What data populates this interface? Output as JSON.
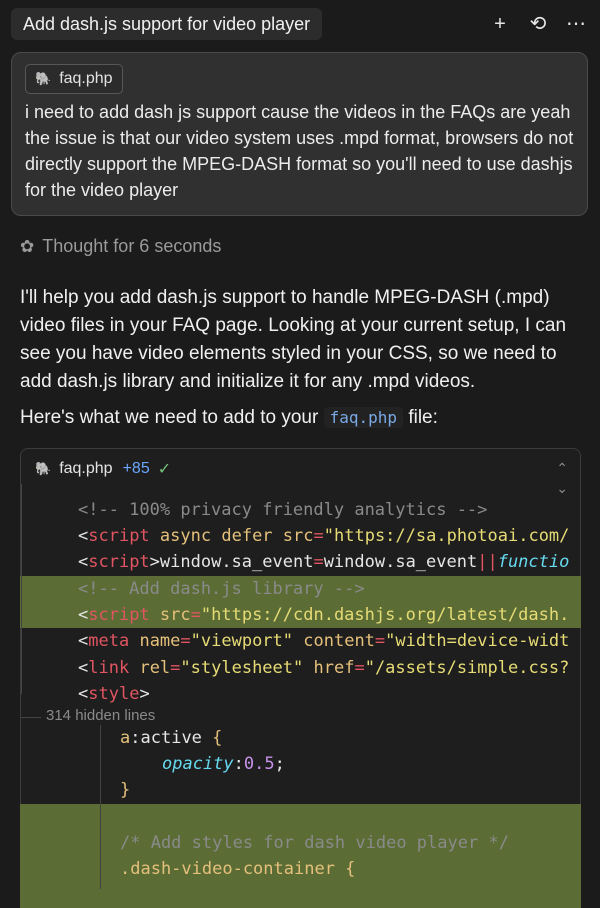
{
  "header": {
    "title": "Add dash.js support for video player",
    "icons": [
      "plus-icon",
      "history-icon",
      "more-icon"
    ]
  },
  "user_message": {
    "file_chip": "faq.php",
    "text": "i need to add dash js support cause the videos in the FAQs are yeah the issue is that our video system uses .mpd format, browsers do not directly support the MPEG-DASH format so you'll need to use dashjs for the video player"
  },
  "thought": {
    "label": "Thought for 6 seconds"
  },
  "answer": {
    "paragraph": "I'll help you add dash.js support to handle MPEG-DASH (.mpd) video files in your FAQ page. Looking at your current setup, I can see you have video elements styled in your CSS, so we need to add dash.js library and initialize it for any .mpd videos.",
    "intro_prefix": "Here's what we need to add to your",
    "intro_file": "faq.php",
    "intro_suffix": "file:"
  },
  "code_block": {
    "file": "faq.php",
    "added_lines": "+85",
    "hidden_lines": "314 hidden lines",
    "lines": [
      {
        "added": false,
        "indent": 0,
        "tokens": [
          [
            "comment",
            "<!-- 100% privacy friendly analytics -->"
          ]
        ]
      },
      {
        "added": false,
        "indent": 0,
        "tokens": [
          [
            "plain",
            "<"
          ],
          [
            "tag",
            "script"
          ],
          [
            "plain",
            " "
          ],
          [
            "attr",
            "async"
          ],
          [
            "plain",
            " "
          ],
          [
            "attr",
            "defer"
          ],
          [
            "plain",
            " "
          ],
          [
            "attr",
            "src"
          ],
          [
            "op",
            "="
          ],
          [
            "str",
            "\"https://sa.photoai.com/"
          ]
        ]
      },
      {
        "added": false,
        "indent": 0,
        "tokens": [
          [
            "plain",
            "<"
          ],
          [
            "tag",
            "script"
          ],
          [
            "plain",
            ">window.sa_event"
          ],
          [
            "op",
            "="
          ],
          [
            "plain",
            "window.sa_event"
          ],
          [
            "op",
            "||"
          ],
          [
            "fn",
            "functio"
          ]
        ]
      },
      {
        "added": true,
        "indent": 0,
        "tokens": [
          [
            "comment",
            "<!-- Add dash.js library -->"
          ]
        ]
      },
      {
        "added": true,
        "indent": 0,
        "tokens": [
          [
            "plain",
            "<"
          ],
          [
            "tag",
            "script"
          ],
          [
            "plain",
            " "
          ],
          [
            "attr",
            "src"
          ],
          [
            "op",
            "="
          ],
          [
            "str",
            "\"https://cdn.dashjs.org/latest/dash."
          ]
        ]
      },
      {
        "added": false,
        "indent": 0,
        "tokens": [
          [
            "plain",
            "<"
          ],
          [
            "tag",
            "meta"
          ],
          [
            "plain",
            " "
          ],
          [
            "attr",
            "name"
          ],
          [
            "op",
            "="
          ],
          [
            "str",
            "\"viewport\""
          ],
          [
            "plain",
            " "
          ],
          [
            "attr",
            "content"
          ],
          [
            "op",
            "="
          ],
          [
            "str",
            "\"width=device-widt"
          ]
        ]
      },
      {
        "added": false,
        "indent": 0,
        "tokens": [
          [
            "plain",
            "<"
          ],
          [
            "tag",
            "link"
          ],
          [
            "plain",
            " "
          ],
          [
            "attr",
            "rel"
          ],
          [
            "op",
            "="
          ],
          [
            "str",
            "\"stylesheet\""
          ],
          [
            "plain",
            " "
          ],
          [
            "attr",
            "href"
          ],
          [
            "op",
            "="
          ],
          [
            "str",
            "\"/assets/simple.css?"
          ]
        ]
      },
      {
        "added": false,
        "indent": 0,
        "tokens": [
          [
            "plain",
            "<"
          ],
          [
            "tag",
            "style"
          ],
          [
            "plain",
            ">"
          ]
        ]
      },
      {
        "added": false,
        "indent": 1,
        "tokens": [
          [
            "sel",
            "a"
          ],
          [
            "plain",
            ":"
          ],
          [
            "plain",
            "active "
          ],
          [
            "brace",
            "{"
          ]
        ]
      },
      {
        "added": false,
        "indent": 2,
        "tokens": [
          [
            "prop",
            "opacity"
          ],
          [
            "plain",
            ":"
          ],
          [
            "num",
            "0.5"
          ],
          [
            "plain",
            ";"
          ]
        ]
      },
      {
        "added": false,
        "indent": 1,
        "tokens": [
          [
            "brace",
            "}"
          ]
        ]
      },
      {
        "added": true,
        "indent": 0,
        "tokens": []
      },
      {
        "added": true,
        "indent": 1,
        "tokens": [
          [
            "comment",
            "/* Add styles for dash video player */"
          ]
        ]
      },
      {
        "added": true,
        "indent": 1,
        "tokens": [
          [
            "class",
            ".dash-video-container "
          ],
          [
            "brace",
            "{"
          ]
        ]
      },
      {
        "added": true,
        "indent": 2,
        "tokens": []
      }
    ]
  }
}
